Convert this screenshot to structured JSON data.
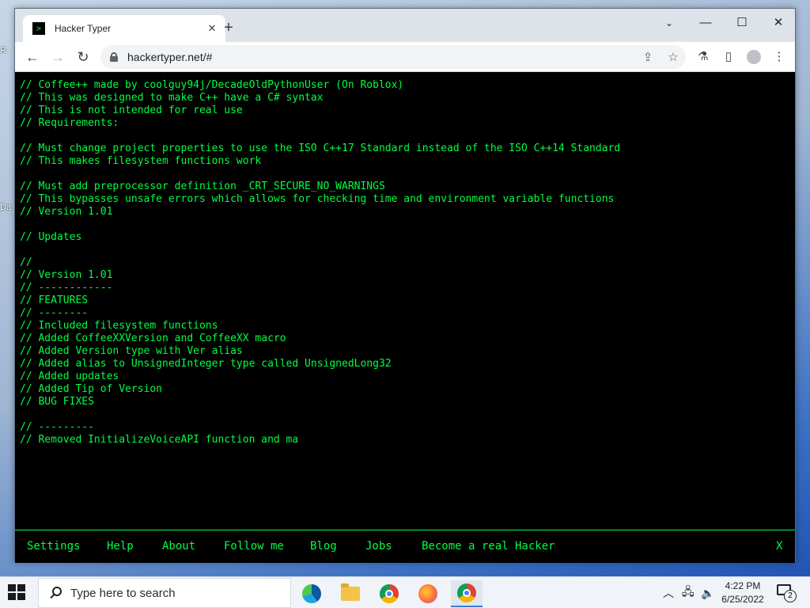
{
  "desktop": {
    "fragment_top": "R",
    "fragment_mid": "Da"
  },
  "browser": {
    "tab": {
      "title": "Hacker Typer",
      "favicon_glyph": ">",
      "close_glyph": "✕"
    },
    "new_tab_glyph": "+",
    "window_controls": {
      "dropdown": "⌄",
      "minimize": "—",
      "maximize": "☐",
      "close": "✕"
    },
    "toolbar": {
      "back": "←",
      "forward": "→",
      "reload": "↻",
      "url": "hackertyper.net/#",
      "share_icon": "⇪",
      "bookmark_icon": "☆",
      "extensions_icon": "⚗",
      "sidepanel_icon": "▯",
      "menu_icon": "⋮"
    }
  },
  "terminal": {
    "lines": [
      "// Coffee++ made by coolguy94j/DecadeOldPythonUser (On Roblox)",
      "// This was designed to make C++ have a C# syntax",
      "// This is not intended for real use",
      "// Requirements:",
      "",
      "// Must change project properties to use the ISO C++17 Standard instead of the ISO C++14 Standard",
      "// This makes filesystem functions work",
      "",
      "// Must add preprocessor definition _CRT_SECURE_NO_WARNINGS",
      "// This bypasses unsafe errors which allows for checking time and environment variable functions",
      "// Version 1.01",
      "",
      "// Updates",
      "",
      "//",
      "// Version 1.01",
      "// ------------",
      "// FEATURES",
      "// --------",
      "// Included filesystem functions",
      "// Added CoffeeXXVersion and CoffeeXX macro",
      "// Added Version type with Ver alias",
      "// Added alias to UnsignedInteger type called UnsignedLong32",
      "// Added updates",
      "// Added Tip of Version",
      "// BUG FIXES",
      "",
      "// ---------",
      "// Removed InitializeVoiceAPI function and ma"
    ]
  },
  "footer": {
    "links": [
      "Settings",
      "Help",
      "About",
      "Follow me",
      "Blog",
      "Jobs",
      "Become a real Hacker"
    ],
    "close": "X"
  },
  "taskbar": {
    "search_placeholder": "Type here to search",
    "tray": {
      "chevron": "︿",
      "network": "🖧",
      "volume": "🔈"
    },
    "clock": {
      "time": "4:22 PM",
      "date": "6/25/2022"
    },
    "notification_count": "2"
  },
  "colors": {
    "terminal_green": "#00ff41",
    "terminal_bg": "#000000"
  }
}
